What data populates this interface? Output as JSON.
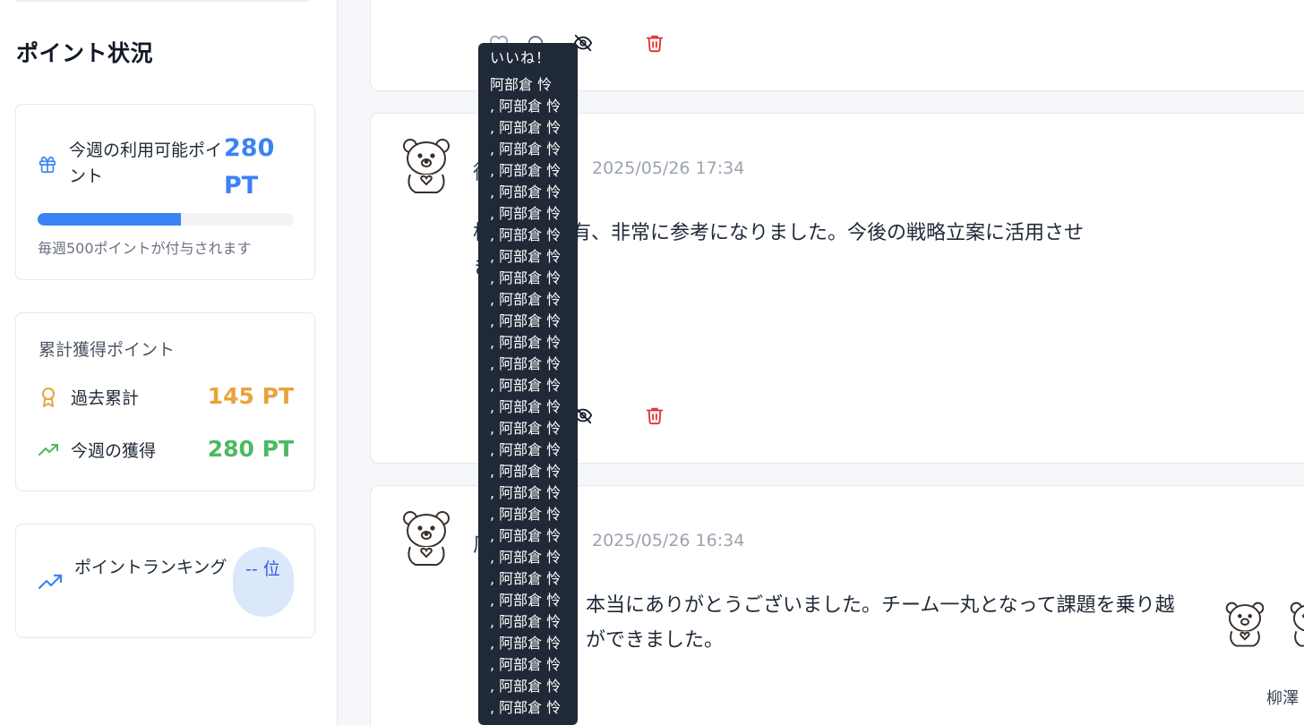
{
  "sidebar": {
    "title": "ポイント状況",
    "available": {
      "label": "今週の利用可能ポイント",
      "value": "280 PT",
      "progress_fraction": 0.56,
      "note": "毎週500ポイントが付与されます"
    },
    "cumulative": {
      "title": "累計獲得ポイント",
      "past_total": {
        "label": "過去累計",
        "value": "145 PT"
      },
      "this_week": {
        "label": "今週の獲得",
        "value": "280 PT"
      }
    },
    "ranking": {
      "label": "ポイントランキング",
      "value": "-- 位"
    }
  },
  "posts": [
    {
      "actions": [
        "heart-icon",
        "comment-icon",
        "eye-off-icon",
        "trash-icon"
      ]
    },
    {
      "author": "徳",
      "timestamp": "2025/05/26 17:34",
      "body": "析の結果共有、非常に参考になりました。今後の戦略立案に活用させ\nきます。"
    },
    {
      "author": "厂",
      "timestamp": "2025/05/26 16:34",
      "body": "本当にありがとうございました。チーム一丸となって課題を乗り越\nができました。",
      "liker_name": "柳澤"
    }
  ],
  "tooltip": {
    "title": "いいね！",
    "first": "阿部倉 怜",
    "rest": [
      ", 阿部倉 怜",
      ", 阿部倉 怜",
      ", 阿部倉 怜",
      ", 阿部倉 怜",
      ", 阿部倉 怜",
      ", 阿部倉 怜",
      ", 阿部倉 怜",
      ", 阿部倉 怜",
      ", 阿部倉 怜",
      ", 阿部倉 怜",
      ", 阿部倉 怜",
      ", 阿部倉 怜",
      ", 阿部倉 怜",
      ", 阿部倉 怜",
      ", 阿部倉 怜",
      ", 阿部倉 怜",
      ", 阿部倉 怜",
      ", 阿部倉 怜",
      ", 阿部倉 怜",
      ", 阿部倉 怜",
      ", 阿部倉 怜",
      ", 阿部倉 怜",
      ", 阿部倉 怜",
      ", 阿部倉 怜",
      ", 阿部倉 怜",
      ", 阿部倉 怜",
      ", 阿部倉 怜",
      ", 阿部倉 怜",
      ", 阿部倉 怜"
    ]
  },
  "colors": {
    "accent_blue": "#3b82f6",
    "orange": "#e8a33d",
    "green": "#4cb963",
    "delete_red": "#e03131",
    "tooltip_bg": "#1f2937"
  }
}
